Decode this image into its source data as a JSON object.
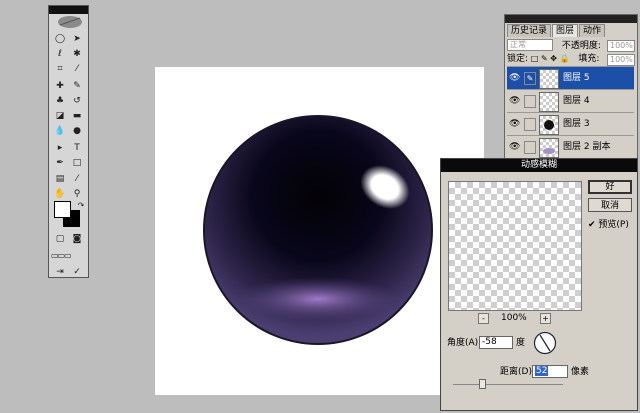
{
  "toolbox": {
    "fg_color": "#ffffff",
    "bg_color": "#000000",
    "tools": [
      "marquee",
      "move",
      "lasso",
      "magic-wand",
      "crop",
      "slice",
      "healing",
      "brush",
      "stamp",
      "history-brush",
      "eraser",
      "gradient",
      "blur",
      "dodge",
      "path-select",
      "type",
      "pen",
      "shape",
      "notes",
      "eyedropper",
      "hand",
      "zoom"
    ]
  },
  "layers_panel": {
    "tabs": [
      "历史记录",
      "图层",
      "动作"
    ],
    "blend_mode": "正常",
    "opacity_label": "不透明度:",
    "opacity_value": "100%",
    "lock_label": "锁定:",
    "fill_label": "填充:",
    "fill_value": "100%",
    "layers": [
      {
        "name": "图层 5",
        "selected": true
      },
      {
        "name": "图层 4",
        "selected": false
      },
      {
        "name": "图层 3",
        "selected": false
      },
      {
        "name": "图层 2 副本",
        "selected": false
      }
    ]
  },
  "dialog": {
    "title": "动感模糊",
    "ok_label": "好",
    "cancel_label": "取消",
    "preview_label": "预览(P)",
    "preview_checked": true,
    "zoom_out": "-",
    "zoom_in": "+",
    "zoom_value": "100%",
    "angle_label": "角度(A):",
    "angle_value": "-58",
    "angle_unit": "度",
    "distance_label": "距离(D):",
    "distance_value": "52",
    "distance_unit": "像素"
  }
}
